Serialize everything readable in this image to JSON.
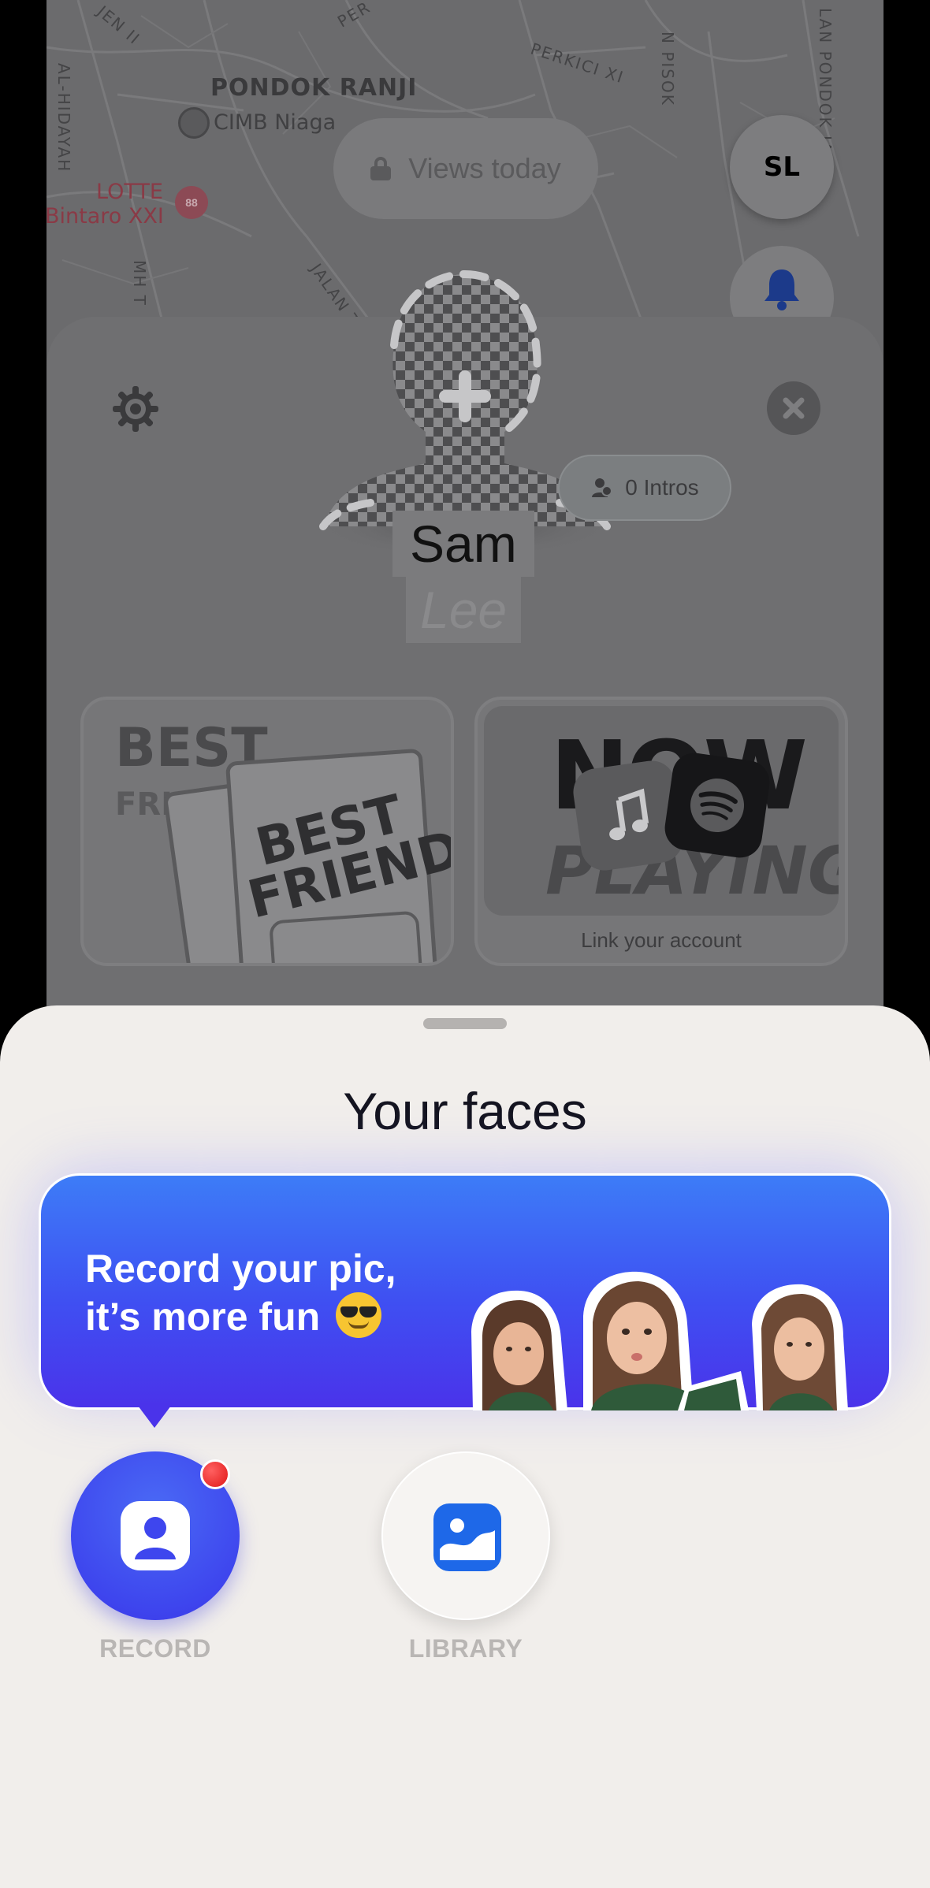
{
  "map": {
    "labels": {
      "area": "PONDOK RANJI",
      "bank": "CIMB Niaga",
      "mall_line1": "LOTTE",
      "mall_line2": "Bintaro XXI",
      "street_1": "JALAN TE",
      "street_2": "MH T",
      "street_3": "AL-HIDAYAH",
      "street_4": "PERKICI XI",
      "street_5": "N PISOK",
      "street_6": "LAN PONDOK JAYA",
      "street_7": "JEN II",
      "street_8": "PER"
    },
    "lotte_pin_text": "88"
  },
  "header": {
    "views_label": "Views today",
    "avatar_initials": "SL"
  },
  "profile": {
    "first_name": "Sam",
    "last_name": "Lee",
    "intros_label": "0 Intros",
    "tiles": {
      "best_friends": {
        "heading": "BEST",
        "subheading": "FRIEN",
        "card_text": "BEST FRIENDS"
      },
      "now_playing": {
        "title_top": "NOW",
        "title_bottom": "PLAYING",
        "caption": "Link your account"
      }
    }
  },
  "sheet": {
    "title": "Your faces",
    "promo_line1": "Record your pic,",
    "promo_line2": "it’s more fun",
    "buttons": {
      "record_label": "RECORD",
      "library_label": "LIBRARY"
    }
  },
  "colors": {
    "accent_blue": "#3e46ee",
    "sheet_bg": "#f1eeeb",
    "notification_red": "#e01818"
  }
}
